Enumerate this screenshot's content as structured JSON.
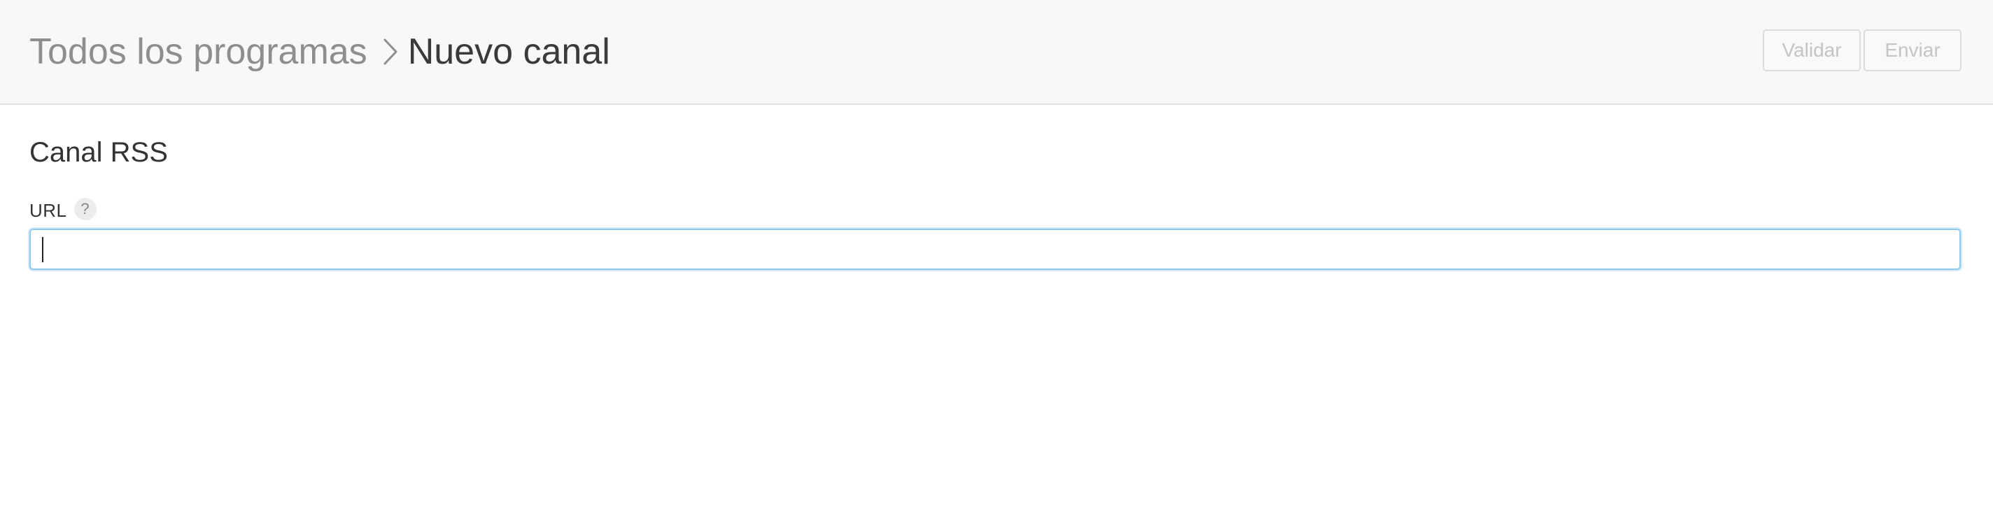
{
  "header": {
    "breadcrumb_parent": "Todos los programas",
    "breadcrumb_current": "Nuevo canal",
    "validate_label": "Validar",
    "send_label": "Enviar"
  },
  "form": {
    "section_title": "Canal RSS",
    "url_label": "URL",
    "help_glyph": "?",
    "url_value": "",
    "url_placeholder": ""
  },
  "icons": {
    "separator": "chevron-right-icon",
    "help": "help-icon"
  },
  "colors": {
    "header_background": "#f8f8f8",
    "input_focus_border": "#8ec9ee",
    "disabled_text": "#c4c4c4"
  }
}
